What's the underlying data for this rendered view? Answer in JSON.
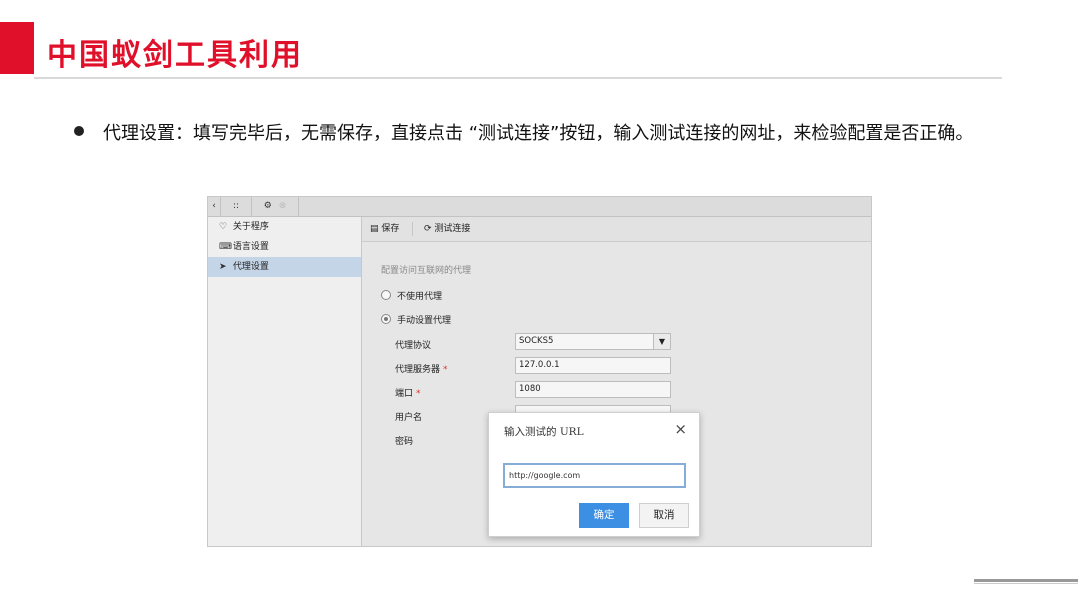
{
  "slide": {
    "title": "中国蚁剑工具利用",
    "bullet": "代理设置：填写完毕后，无需保存，直接点击 “测试连接”按钮，输入测试连接的网址，来检验配置是否正确。"
  },
  "app": {
    "toolbar": {
      "grid_icon": "::",
      "gear_icon": "⚙",
      "close_icon": "⊗",
      "arrow": "‹"
    },
    "sidebar": {
      "items": [
        {
          "icon": "♡",
          "label": "关于程序"
        },
        {
          "icon": "⌨",
          "label": "语言设置"
        },
        {
          "icon": "➤",
          "label": "代理设置"
        }
      ]
    },
    "content_toolbar": {
      "save_icon": "▤",
      "save_label": "保存",
      "test_icon": "⟳",
      "test_label": "测试连接"
    },
    "form": {
      "caption": "配置访问互联网的代理",
      "radio_none": "不使用代理",
      "radio_manual": "手动设置代理",
      "protocol_label": "代理协议",
      "protocol_value": "SOCKS5",
      "server_label": "代理服务器",
      "server_value": "127.0.0.1",
      "port_label": "端口",
      "port_value": "1080",
      "username_label": "用户名",
      "password_label": "密码",
      "required_mark": "*"
    },
    "modal": {
      "title": "输入测试的 URL",
      "close": "×",
      "input_value": "http://google.com",
      "ok_label": "确定",
      "cancel_label": "取消"
    }
  }
}
